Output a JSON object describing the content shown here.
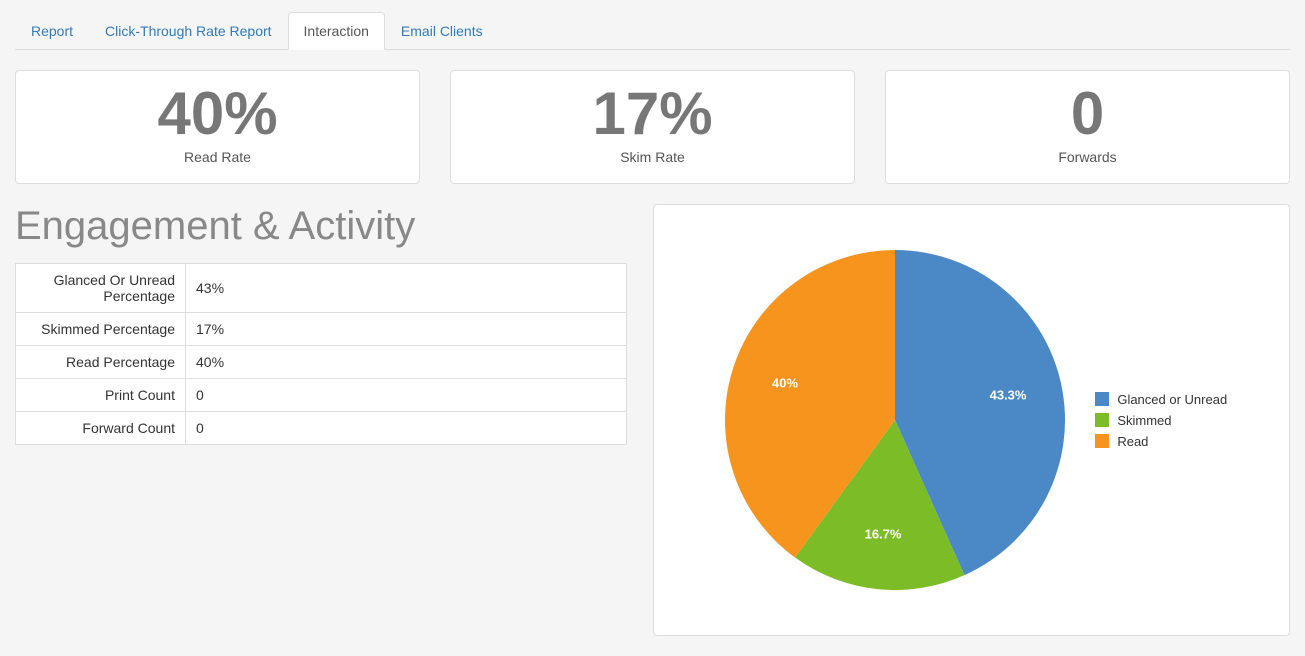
{
  "tabs": {
    "report": "Report",
    "ctr": "Click-Through Rate Report",
    "interaction": "Interaction",
    "clients": "Email Clients"
  },
  "stats": {
    "read_rate": {
      "value": "40%",
      "label": "Read Rate"
    },
    "skim_rate": {
      "value": "17%",
      "label": "Skim Rate"
    },
    "forwards": {
      "value": "0",
      "label": "Forwards"
    }
  },
  "section_title": "Engagement & Activity",
  "table": {
    "r0k": "Glanced Or Unread Percentage",
    "r0v": "43%",
    "r1k": "Skimmed Percentage",
    "r1v": "17%",
    "r2k": "Read Percentage",
    "r2v": "40%",
    "r3k": "Print Count",
    "r3v": "0",
    "r4k": "Forward Count",
    "r4v": "0"
  },
  "chart_data": {
    "type": "pie",
    "title": "",
    "series": [
      {
        "name": "Glanced or Unread",
        "value": 43.3,
        "color": "#4a89c5",
        "label": "43.3%"
      },
      {
        "name": "Skimmed",
        "value": 16.7,
        "color": "#7cbd27",
        "label": "16.7%"
      },
      {
        "name": "Read",
        "value": 40.0,
        "color": "#f7941e",
        "label": "40%"
      }
    ]
  }
}
